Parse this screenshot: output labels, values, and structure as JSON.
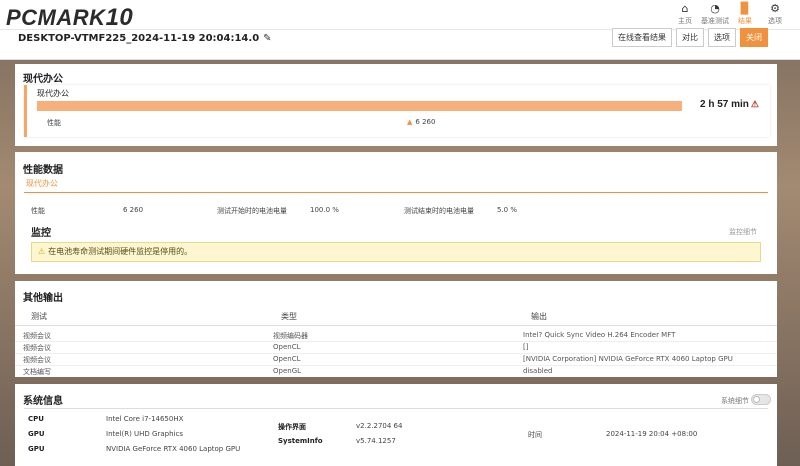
{
  "app": {
    "logo_text": "PCMARK",
    "logo_num": "10",
    "nav": [
      {
        "label": "主页",
        "icon": "home-icon"
      },
      {
        "label": "基准测试",
        "icon": "gauge-icon"
      },
      {
        "label": "结果",
        "icon": "bar-chart-icon"
      },
      {
        "label": "选项",
        "icon": "gear-icon"
      }
    ]
  },
  "header": {
    "result_name": "DESKTOP-VTMF225_2024-11-19 20:04:14.0",
    "buttons": {
      "view_online": "在线查看结果",
      "compare": "对比",
      "options": "选项",
      "close": "关闭"
    }
  },
  "modern_office": {
    "title": "现代办公",
    "test_name": "现代办公",
    "duration": "2 h 57 min",
    "perf_label": "性能",
    "perf_value": "6 260",
    "progress_fraction": 0.94
  },
  "performance_data": {
    "title": "性能数据",
    "tab": "现代办公",
    "perf_label": "性能",
    "perf_value": "6 260",
    "start_battery_label": "测试开始时的电池电量",
    "start_battery_value": "100.0 %",
    "end_battery_label": "测试结束时的电池电量",
    "end_battery_value": "5.0 %",
    "monitor_title": "监控",
    "monitor_detail": "监控细节",
    "alert_text": "在电池寿命测试期间硬件监控是停用的。"
  },
  "other_output": {
    "title": "其他输出",
    "headers": [
      "测试",
      "类型",
      "输出"
    ],
    "rows": [
      [
        "视频会议",
        "视频编码器",
        "Intel? Quick Sync Video H.264 Encoder MFT"
      ],
      [
        "视频会议",
        "OpenCL",
        "[]"
      ],
      [
        "视频会议",
        "OpenCL",
        "[NVIDIA Corporation] NVIDIA GeForce RTX 4060 Laptop GPU"
      ],
      [
        "文档编写",
        "OpenGL",
        "disabled"
      ]
    ]
  },
  "system_info": {
    "title": "系统信息",
    "detail_label": "系统细节",
    "cpu_label": "CPU",
    "cpu_value": "Intel Core i7-14650HX",
    "gpu1_label": "GPU",
    "gpu1_value": "Intel(R) UHD Graphics",
    "gpu2_label": "GPU",
    "gpu2_value": "NVIDIA GeForce RTX 4060 Laptop GPU",
    "os_label": "操作界面",
    "os_value": "v2.2.2704 64",
    "sysinfo_label": "SystemInfo",
    "sysinfo_value": "v5.74.1257",
    "time_label": "时间",
    "time_value": "2024-11-19 20:04 +08:00"
  }
}
